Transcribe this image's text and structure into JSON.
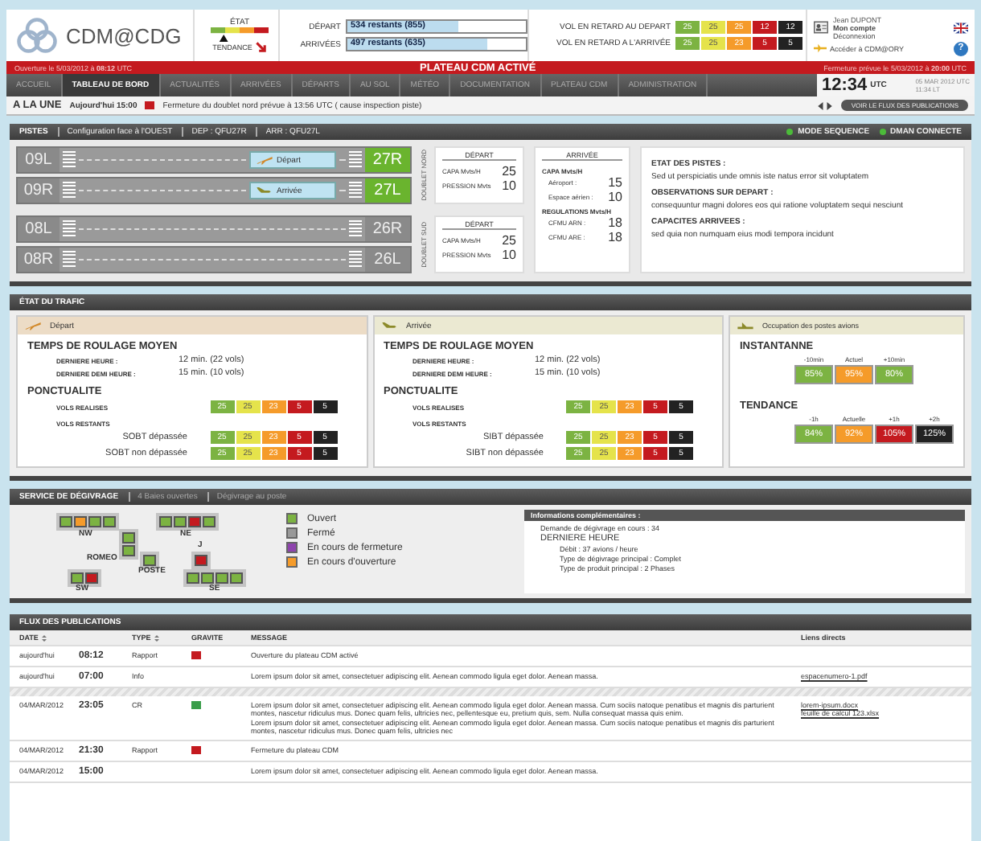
{
  "header": {
    "logo": "CDM@CDG",
    "state_label": "ÉTAT",
    "trend_label": "TENDANCE",
    "counters": [
      {
        "label": "DÉPART",
        "value": "534 restants (855)",
        "level": 0.62
      },
      {
        "label": "ARRIVÉES",
        "value": "497 restants (635)",
        "level": 0.78
      }
    ],
    "delays": [
      {
        "label": "VOL EN RETARD AU DEPART",
        "scores": [
          {
            "value": "25",
            "color": "#7cb342"
          },
          {
            "value": "25",
            "color": "#e5e34b"
          },
          {
            "value": "25",
            "color": "#f59b2a"
          },
          {
            "value": "12",
            "color": "#c41a1f"
          },
          {
            "value": "12",
            "color": "#222222"
          }
        ]
      },
      {
        "label": "VOL EN RETARD A L'ARRIVÉE",
        "scores": [
          {
            "value": "25",
            "color": "#7cb342"
          },
          {
            "value": "25",
            "color": "#e5e34b"
          },
          {
            "value": "23",
            "color": "#f59b2a"
          },
          {
            "value": "5",
            "color": "#c41a1f"
          },
          {
            "value": "5",
            "color": "#222222"
          }
        ]
      }
    ],
    "user": {
      "name": "Jean DUPONT",
      "account": "Mon compte",
      "logout": "Déconnexion",
      "switch_link": "Accéder à CDM@ORY",
      "help": "?"
    }
  },
  "status_bar": {
    "opening": "Ouverture le 5/03/2012 à **08:12** UTC",
    "title": "PLATEAU CDM ACTIVÉ",
    "closing": "Fermeture prévue le 5/03/2012 à **20:00** UTC"
  },
  "nav": {
    "tabs": [
      {
        "label": "ACCUEIL",
        "selected": false
      },
      {
        "label": "TABLEAU DE BORD",
        "selected": true
      },
      {
        "label": "ACTUALITÉS",
        "selected": false
      },
      {
        "label": "ARRIVÉES",
        "selected": false
      },
      {
        "label": "DÉPARTS",
        "selected": false
      },
      {
        "label": "AU SOL",
        "selected": false
      },
      {
        "label": "MÉTÉO",
        "selected": false
      },
      {
        "label": "DOCUMENTATION",
        "selected": false
      },
      {
        "label": "PLATEAU CDM",
        "selected": false
      },
      {
        "label": "ADMINISTRATION",
        "selected": false
      }
    ],
    "clock": {
      "time": "12:34",
      "zone": "UTC",
      "date": "05 MAR 2012 UTC",
      "local": "11:34 LT"
    }
  },
  "headline": {
    "title": "A LA UNE",
    "time": "Aujourd'hui 15:00",
    "color": "#c41a1f",
    "text": "Fermeture du doublet nord prévue à 13:56 UTC ( cause inspection piste)",
    "button": "VOIR LE FLUX DES PUBLICATIONS"
  },
  "runways": {
    "title": "PISTES",
    "config": "Configuration face à l'OUEST",
    "dep": "DEP : QFU27R",
    "arr": "ARR : QFU27L",
    "indicators": [
      {
        "label": "MODE SEQUENCE",
        "on": true
      },
      {
        "label": "DMAN CONNECTE",
        "on": true
      }
    ],
    "doublets": [
      {
        "label": "DOUBLET NORD",
        "strips": [
          {
            "left": "09L",
            "right": "27R",
            "active": true,
            "tag": "Départ",
            "kind": "departure"
          },
          {
            "left": "09R",
            "right": "27L",
            "active": true,
            "tag": "Arrivée",
            "kind": "arrival"
          }
        ],
        "departure": {
          "title": "DÉPART",
          "rows": [
            {
              "label": "CAPA Mvts/H",
              "value": "25"
            },
            {
              "label": "PRESSION Mvts",
              "value": "10"
            }
          ]
        }
      },
      {
        "label": "DOUBLET SUD",
        "strips": [
          {
            "left": "08L",
            "right": "26R",
            "active": false
          },
          {
            "left": "08R",
            "right": "26L",
            "active": false
          }
        ],
        "departure": {
          "title": "DÉPART",
          "rows": [
            {
              "label": "CAPA Mvts/H",
              "value": "25"
            },
            {
              "label": "PRESSION Mvts",
              "value": "10"
            }
          ]
        }
      }
    ],
    "arrival": {
      "title": "ARRIVÉE",
      "capa_title": "CAPA Mvts/H",
      "capa": [
        {
          "label": "Aéroport :",
          "value": "15"
        },
        {
          "label": "Espace aérien :",
          "value": "10"
        }
      ],
      "reg_title": "REGULATIONS Mvts/H",
      "regulations": [
        {
          "label": "CFMU ARN :",
          "value": "18"
        },
        {
          "label": "CFMU ARE :",
          "value": "18"
        }
      ]
    },
    "notes": [
      {
        "title": "ETAT DES PISTES :",
        "text": "Sed ut perspiciatis unde omnis iste natus error sit voluptatem"
      },
      {
        "title": "OBSERVATIONS SUR DEPART :",
        "text": "consequuntur magni dolores eos qui ratione voluptatem sequi nesciunt"
      },
      {
        "title": "CAPACITES ARRIVEES :",
        "text": "sed quia non numquam eius modi tempora incidunt"
      }
    ]
  },
  "traffic": {
    "title": "ÉTAT DU TRAFIC",
    "panels": [
      {
        "kind": "departure",
        "title": "Départ",
        "taxi_title": "TEMPS DE ROULAGE MOYEN",
        "taxi": [
          {
            "label": "DERNIERE HEURE :",
            "value": "12 min. (22 vols)"
          },
          {
            "label": "DERNIERE DEMI HEURE :",
            "value": "15 min. (10 vols)"
          }
        ],
        "punct_title": "PONCTUALITE",
        "done_label": "VOLS REALISES",
        "done": [
          {
            "value": "25",
            "color": "#7cb342"
          },
          {
            "value": "25",
            "color": "#e5e34b"
          },
          {
            "value": "23",
            "color": "#f59b2a"
          },
          {
            "value": "5",
            "color": "#c41a1f"
          },
          {
            "value": "5",
            "color": "#222222"
          }
        ],
        "remaining_label": "VOLS RESTANTS",
        "remaining": [
          {
            "label": "SOBT dépassée",
            "scores": [
              {
                "value": "25",
                "color": "#7cb342"
              },
              {
                "value": "25",
                "color": "#e5e34b"
              },
              {
                "value": "23",
                "color": "#f59b2a"
              },
              {
                "value": "5",
                "color": "#c41a1f"
              },
              {
                "value": "5",
                "color": "#222222"
              }
            ]
          },
          {
            "label": "SOBT non dépassée",
            "scores": [
              {
                "value": "25",
                "color": "#7cb342"
              },
              {
                "value": "25",
                "color": "#e5e34b"
              },
              {
                "value": "23",
                "color": "#f59b2a"
              },
              {
                "value": "5",
                "color": "#c41a1f"
              },
              {
                "value": "5",
                "color": "#222222"
              }
            ]
          }
        ]
      },
      {
        "kind": "arrival",
        "title": "Arrivée",
        "taxi_title": "TEMPS DE ROULAGE MOYEN",
        "taxi": [
          {
            "label": "DERNIERE HEURE :",
            "value": "12 min. (22 vols)"
          },
          {
            "label": "DERNIERE DEMI HEURE :",
            "value": "15 min. (10 vols)"
          }
        ],
        "punct_title": "PONCTUALITE",
        "done_label": "VOLS REALISES",
        "done": [
          {
            "value": "25",
            "color": "#7cb342"
          },
          {
            "value": "25",
            "color": "#e5e34b"
          },
          {
            "value": "23",
            "color": "#f59b2a"
          },
          {
            "value": "5",
            "color": "#c41a1f"
          },
          {
            "value": "5",
            "color": "#222222"
          }
        ],
        "remaining_label": "VOLS RESTANTS",
        "remaining": [
          {
            "label": "SIBT dépassée",
            "scores": [
              {
                "value": "25",
                "color": "#7cb342"
              },
              {
                "value": "25",
                "color": "#e5e34b"
              },
              {
                "value": "23",
                "color": "#f59b2a"
              },
              {
                "value": "5",
                "color": "#c41a1f"
              },
              {
                "value": "5",
                "color": "#222222"
              }
            ]
          },
          {
            "label": "SIBT non dépassée",
            "scores": [
              {
                "value": "25",
                "color": "#7cb342"
              },
              {
                "value": "25",
                "color": "#e5e34b"
              },
              {
                "value": "23",
                "color": "#f59b2a"
              },
              {
                "value": "5",
                "color": "#c41a1f"
              },
              {
                "value": "5",
                "color": "#222222"
              }
            ]
          }
        ]
      }
    ],
    "occupancy": {
      "title": "Occupation des postes avions",
      "now_title": "INSTANTANNE",
      "now": [
        {
          "label": "-10min",
          "value": "85%",
          "color": "#7cb342"
        },
        {
          "label": "Actuel",
          "value": "95%",
          "color": "#f59b2a"
        },
        {
          "label": "+10min",
          "value": "80%",
          "color": "#7cb342"
        }
      ],
      "trend_title": "TENDANCE",
      "trend": [
        {
          "label": "-1h",
          "value": "84%",
          "color": "#7cb342"
        },
        {
          "label": "Actuelle",
          "value": "92%",
          "color": "#f59b2a"
        },
        {
          "label": "+1h",
          "value": "105%",
          "color": "#c41a1f"
        },
        {
          "label": "+2h",
          "value": "125%",
          "color": "#222222"
        }
      ]
    }
  },
  "deicing": {
    "title": "SERVICE DE DÉGIVRAGE",
    "open_bays": "4 Baies ouvertes",
    "mode": "Dégivrage au poste",
    "zones": [
      {
        "label": "NW",
        "bays": [
          {
            "color": "#7cb342"
          },
          {
            "color": "#f59b2a"
          },
          {
            "color": "#7cb342"
          },
          {
            "color": "#7cb342"
          }
        ]
      },
      {
        "label": "NE",
        "bays": [
          {
            "color": "#7cb342"
          },
          {
            "color": "#7cb342"
          },
          {
            "color": "#c41a1f"
          },
          {
            "color": "#7cb342"
          }
        ]
      },
      {
        "label": "ROMEO",
        "bays": [
          {
            "color": "#7cb342"
          },
          {
            "color": "#7cb342"
          }
        ]
      },
      {
        "label": "J",
        "bays": [
          {
            "color": "#c41a1f"
          }
        ]
      },
      {
        "label": "POSTE",
        "bays": [
          {
            "color": "#7cb342"
          }
        ]
      },
      {
        "label": "SW",
        "bays": [
          {
            "color": "#7cb342"
          },
          {
            "color": "#c41a1f"
          }
        ]
      },
      {
        "label": "SE",
        "bays": [
          {
            "color": "#7cb342"
          },
          {
            "color": "#7cb342"
          },
          {
            "color": "#7cb342"
          },
          {
            "color": "#7cb342"
          }
        ]
      }
    ],
    "legend": [
      {
        "label": "Ouvert",
        "color": "#7cb342"
      },
      {
        "label": "Fermé",
        "color": "#999999"
      },
      {
        "label": "En cours de fermeture",
        "color": "#8e44ad"
      },
      {
        "label": "En cours d'ouverture",
        "color": "#f59b2a"
      }
    ],
    "info": {
      "title": "Informations complémentaires :",
      "demand": "Demande de dégivrage en cours : 34",
      "hour_title": "DERNIERE HEURE",
      "details": [
        "Débit : 37 avions / heure",
        "Type de dégivrage principal : Complet",
        "Type de produit principal : 2 Phases"
      ]
    }
  },
  "feed": {
    "title": "FLUX DES PUBLICATIONS",
    "columns": [
      "DATE",
      "TYPE",
      "GRAVITE",
      "MESSAGE",
      "Liens directs"
    ],
    "rows": [
      {
        "date": "aujourd'hui",
        "time": "08:12",
        "type": "Rapport",
        "color": "#c41a1f",
        "message": [
          "Ouverture du plateau CDM activé"
        ],
        "links": []
      },
      {
        "date": "aujourd'hui",
        "time": "07:00",
        "type": "Info",
        "message": [
          "Lorem ipsum dolor sit amet, consectetuer adipiscing elit. Aenean commodo ligula eget dolor. Aenean massa."
        ],
        "links": [
          "espacenumero-1.pdf"
        ]
      },
      {
        "date": "04/MAR/2012",
        "time": "23:05",
        "type": "CR",
        "color": "#3a9d4a",
        "message": [
          "Lorem ipsum dolor sit amet, consectetuer adipiscing elit. Aenean commodo ligula eget dolor. Aenean massa. Cum sociis natoque penatibus et magnis dis parturient montes, nascetur ridiculus mus. Donec quam felis, ultricies nec, pellentesque eu, pretium quis, sem. Nulla consequat massa quis enim.",
          "Lorem ipsum dolor sit amet, consectetuer adipiscing elit. Aenean commodo ligula eget dolor. Aenean massa. Cum sociis natoque penatibus et magnis dis parturient montes, nascetur ridiculus mus. Donec quam felis, ultricies nec"
        ],
        "links": [
          "lorem-ipsum.docx",
          "feuille de calcul 123.xlsx"
        ]
      },
      {
        "date": "04/MAR/2012",
        "time": "21:30",
        "type": "Rapport",
        "color": "#c41a1f",
        "message": [
          "Fermeture du plateau CDM"
        ],
        "links": []
      },
      {
        "date": "04/MAR/2012",
        "time": "15:00",
        "type": "",
        "message": [
          "Lorem ipsum dolor sit amet, consectetuer adipiscing elit. Aenean commodo ligula eget dolor. Aenean massa."
        ],
        "links": []
      }
    ]
  }
}
